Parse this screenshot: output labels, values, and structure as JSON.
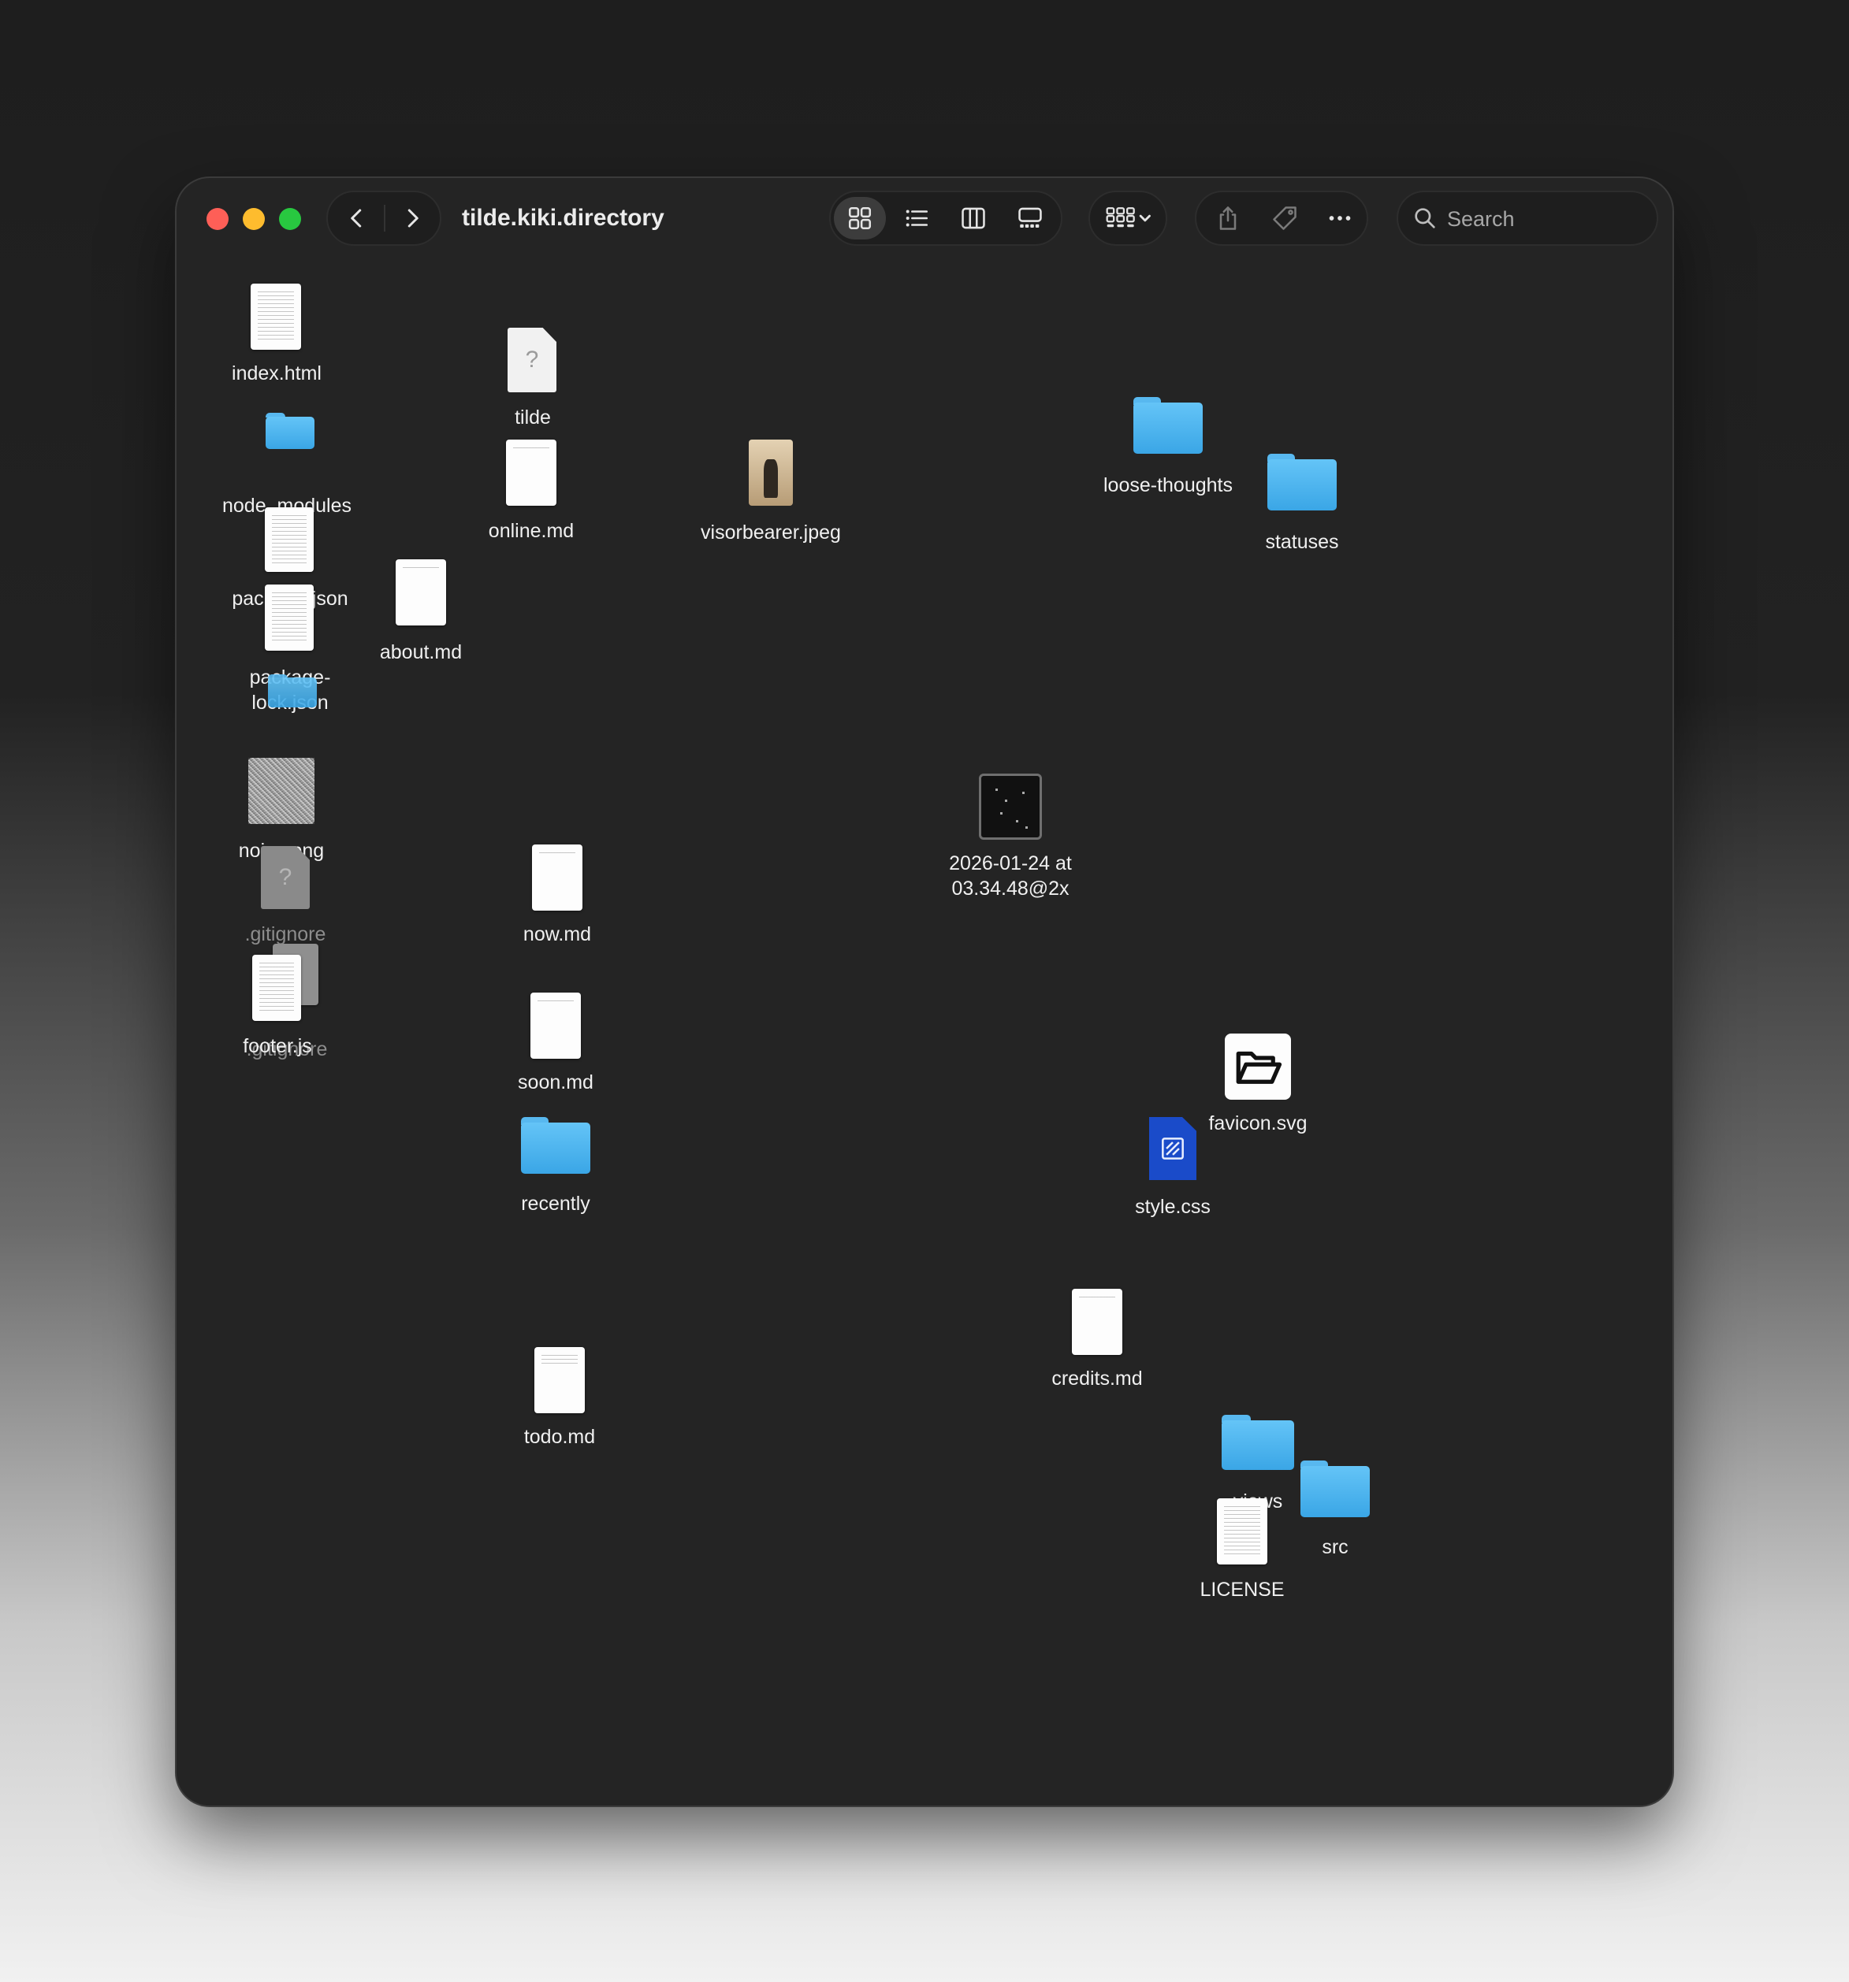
{
  "window": {
    "title": "tilde.kiki.directory"
  },
  "toolbar": {
    "search_placeholder": "Search",
    "view_modes": [
      "icon-view",
      "list-view",
      "column-view",
      "gallery-view"
    ],
    "active_view": "icon-view"
  },
  "colors": {
    "window_bg": "#242424",
    "folder": "#4fb3ee",
    "close": "#fe5f57",
    "minimize": "#febc2e",
    "zoom": "#28c840",
    "css_icon": "#1a4bc9"
  },
  "items": [
    {
      "name": "index.html",
      "kind": "document"
    },
    {
      "name": "tilde",
      "kind": "unknown"
    },
    {
      "name": "node_modules",
      "kind": "folder"
    },
    {
      "name": "online.md",
      "kind": "document"
    },
    {
      "name": "visorbearer.jpeg",
      "kind": "image"
    },
    {
      "name": "loose-thoughts",
      "kind": "folder"
    },
    {
      "name": "statuses",
      "kind": "folder"
    },
    {
      "name": "package.json",
      "kind": "document"
    },
    {
      "name": "about.md",
      "kind": "document"
    },
    {
      "name": "package-\nlock.json",
      "kind": "document"
    },
    {
      "name": "",
      "kind": "folder"
    },
    {
      "name": "noise.png",
      "kind": "image"
    },
    {
      "name": "2026-01-24 at\n03.34.48@2x",
      "kind": "image"
    },
    {
      "name": ".gitignore",
      "kind": "unknown"
    },
    {
      "name": "now.md",
      "kind": "document"
    },
    {
      "name": ".gitignore",
      "kind": "document"
    },
    {
      "name": "footer.js",
      "kind": "document"
    },
    {
      "name": "soon.md",
      "kind": "document"
    },
    {
      "name": "favicon.svg",
      "kind": "image"
    },
    {
      "name": "recently",
      "kind": "folder"
    },
    {
      "name": "style.css",
      "kind": "document"
    },
    {
      "name": "credits.md",
      "kind": "document"
    },
    {
      "name": "todo.md",
      "kind": "document"
    },
    {
      "name": "views",
      "kind": "folder"
    },
    {
      "name": "src",
      "kind": "folder"
    },
    {
      "name": "LICENSE",
      "kind": "document"
    }
  ]
}
